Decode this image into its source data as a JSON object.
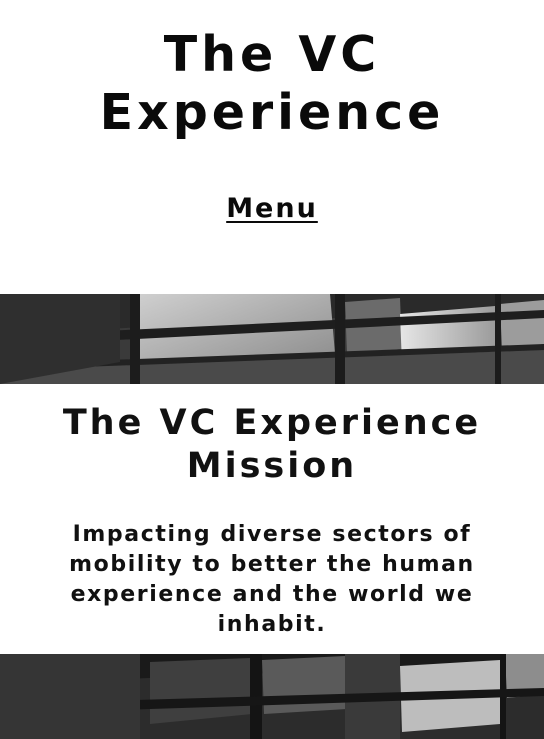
{
  "header": {
    "site_title": "The VC Experience",
    "menu_label": "Menu"
  },
  "mission": {
    "title": "The VC Experience Mission",
    "text": "Impacting diverse sectors of mobility to better the human experience and the world we inhabit."
  },
  "banner": {
    "image": "building-facade-grayscale-photo"
  }
}
